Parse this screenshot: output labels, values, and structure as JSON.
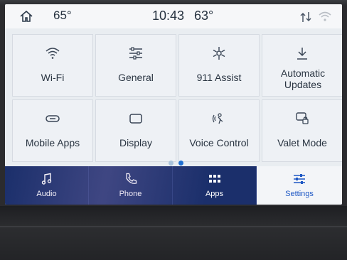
{
  "status_bar": {
    "outside_temp": "65°",
    "clock": "10:43",
    "cabin_temp": "63°",
    "icons": [
      "home-icon",
      "signal-icon",
      "wifi-status-icon"
    ]
  },
  "tiles": [
    {
      "label": "Wi-Fi",
      "icon": "wifi-icon"
    },
    {
      "label": "General",
      "icon": "sliders-icon"
    },
    {
      "label": "911 Assist",
      "icon": "assist-icon"
    },
    {
      "label": "Automatic Updates",
      "icon": "download-icon"
    },
    {
      "label": "Mobile Apps",
      "icon": "link-icon"
    },
    {
      "label": "Display",
      "icon": "display-icon"
    },
    {
      "label": "Voice Control",
      "icon": "voice-icon"
    },
    {
      "label": "Valet Mode",
      "icon": "valet-lock-icon"
    }
  ],
  "pager": {
    "pages": 2,
    "current": 2
  },
  "nav": [
    {
      "label": "Audio",
      "icon": "music-note-icon"
    },
    {
      "label": "Phone",
      "icon": "phone-icon"
    },
    {
      "label": "Apps",
      "icon": "apps-grid-icon"
    },
    {
      "label": "Settings",
      "icon": "sliders-icon",
      "active": true
    }
  ],
  "colors": {
    "nav_background": "#1b2f6b",
    "active_accent": "#1d57c4",
    "screen_background": "#e9edf1"
  }
}
